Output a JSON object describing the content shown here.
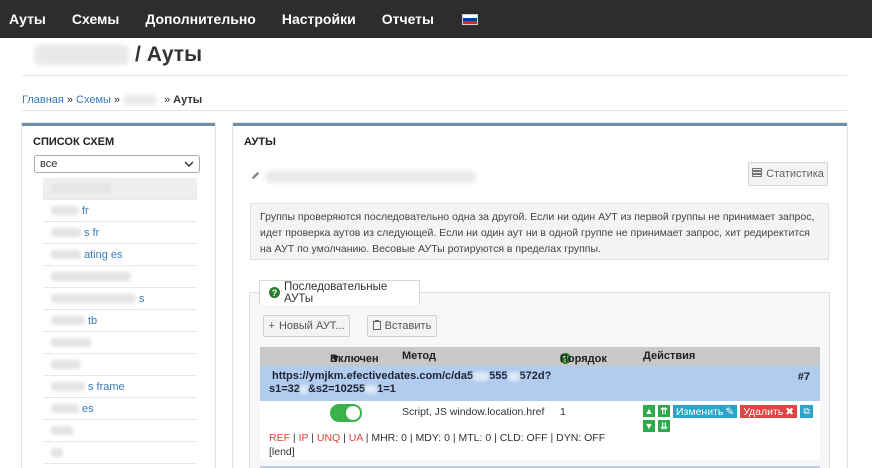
{
  "nav": {
    "items": [
      "Ауты",
      "Схемы",
      "Дополнительно",
      "Настройки",
      "Отчеты"
    ],
    "language": "ru"
  },
  "title": {
    "prefix": "Schema",
    "sep": "/",
    "text": "Ауты"
  },
  "breadcrumb": {
    "home": "Главная",
    "sep": "»",
    "schemes": "Схемы",
    "current": "Ауты"
  },
  "sidebar": {
    "title": "СПИСОК СХЕМ",
    "filter": "все",
    "items": [
      {
        "tail": "",
        "active": true
      },
      {
        "tail": "fr",
        "active": false
      },
      {
        "tail": "s fr",
        "active": false
      },
      {
        "tail": "ating es",
        "active": false
      },
      {
        "tail": "",
        "active": false
      },
      {
        "tail": "s",
        "active": false
      },
      {
        "tail": "tb",
        "active": false
      },
      {
        "tail": "",
        "active": false
      },
      {
        "tail": "",
        "active": false
      },
      {
        "tail": "s frame",
        "active": false
      },
      {
        "tail": "es",
        "active": false
      },
      {
        "tail": "",
        "active": false
      },
      {
        "tail": "",
        "active": false
      }
    ]
  },
  "main": {
    "title": "АУТЫ",
    "url_prefix": "https://",
    "stats_button": "Статистика",
    "info": "Группы проверяются последовательно одна за другой. Если ни один АУТ из первой группы не принимает запрос, идет проверка аутов из следующей. Если ни один аут ни в одной группе не принимает запрос, хит редиректится на АУТ по умолчанию. Весовые АУТы ротируются в пределах группы.",
    "tab": "Последовательные АУТы",
    "new_button": "Новый АУТ...",
    "paste_button": "Вставить"
  },
  "table": {
    "headers": {
      "enabled": "Включен",
      "method": "Метод",
      "order": "Порядок",
      "actions": "Действия"
    },
    "row": {
      "url_a": "https://ymjkm.efectivedates.com/c/da5",
      "url_b": "555",
      "url_c": "572d?",
      "url_d": "s1=32",
      "url_e": "&s2=10255",
      "url_f": "1=1",
      "number": "#7",
      "enabled": true,
      "method": "Script, JS window.location.href",
      "order": "1",
      "edit": "Изменить",
      "delete": "Удалить",
      "flags_red": [
        "REF",
        "IP",
        "UNQ",
        "UA"
      ],
      "flags_rest": "| MHR: 0 | MDY: 0 | MTL: 0 | CLD: OFF | DYN: OFF",
      "lend": "[lend]"
    }
  }
}
